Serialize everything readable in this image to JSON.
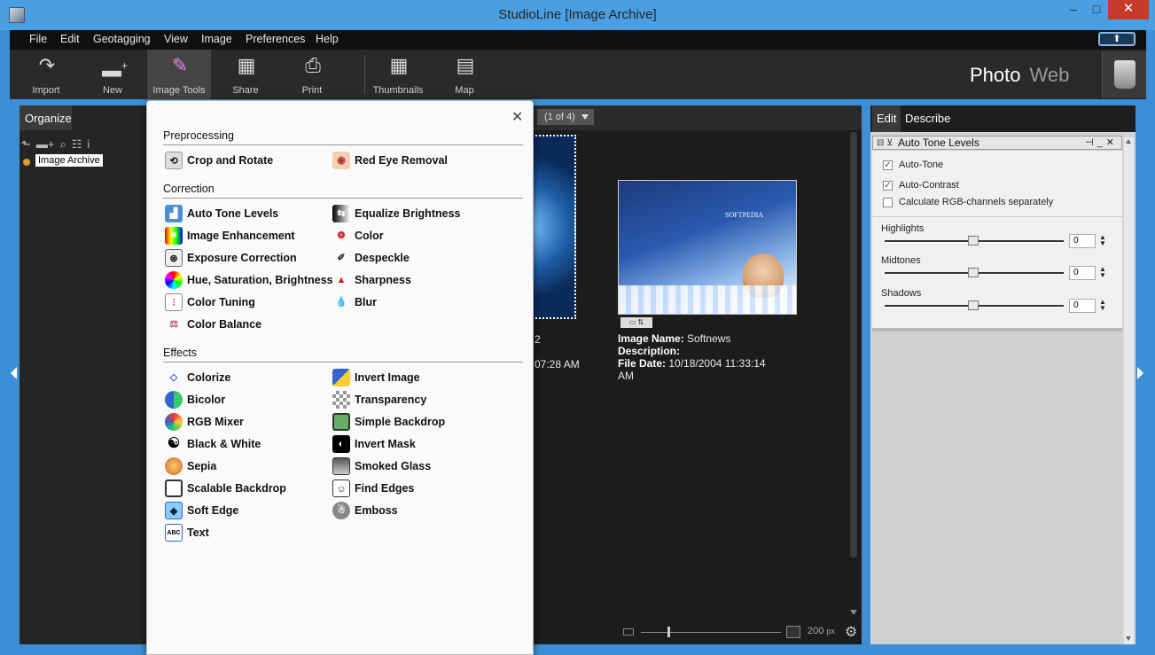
{
  "window": {
    "title": "StudioLine [Image Archive]",
    "min": "–",
    "max": "□",
    "close": "✕"
  },
  "menu": [
    "File",
    "Edit",
    "Geotagging",
    "View",
    "Image",
    "Preferences",
    "Help"
  ],
  "toolbar": {
    "import": "Import",
    "new": "New",
    "image_tools": "Image Tools",
    "share": "Share",
    "print": "Print",
    "thumbnails": "Thumbnails",
    "map": "Map",
    "photo": "Photo",
    "web": "Web"
  },
  "left": {
    "tab": "Organize",
    "tree_item": "Image Archive"
  },
  "center": {
    "page_indicator": "(1 of 4)",
    "thumb1_info": [
      "2",
      "07:28 AM"
    ],
    "thumb2_info": {
      "name_label": "Image Name:",
      "name_value": "Softnews",
      "desc_label": "Description:",
      "date_label": "File Date:",
      "date_value": "10/18/2004 11:33:14",
      "date_value2": "AM"
    },
    "zoom_value": "200",
    "zoom_unit": "px"
  },
  "right": {
    "tab_edit": "Edit",
    "tab_describe": "Describe",
    "panel_title": "Auto Tone Levels",
    "checkboxes": [
      {
        "label": "Auto-Tone",
        "checked": true
      },
      {
        "label": "Auto-Contrast",
        "checked": true
      },
      {
        "label": "Calculate RGB-channels separately",
        "checked": false
      }
    ],
    "sliders": [
      {
        "label": "Highlights",
        "value": "0"
      },
      {
        "label": "Midtones",
        "value": "0"
      },
      {
        "label": "Shadows",
        "value": "0"
      }
    ]
  },
  "popup": {
    "sections": {
      "preprocessing": "Preprocessing",
      "correction": "Correction",
      "effects": "Effects"
    },
    "preprocessing": [
      "Crop and Rotate",
      "Red Eye Removal"
    ],
    "correction_left": [
      "Auto Tone Levels",
      "Image Enhancement",
      "Exposure Correction",
      "Hue, Saturation, Brightness",
      "Color Tuning",
      "Color Balance"
    ],
    "correction_right": [
      "Equalize Brightness",
      "Color",
      "Despeckle",
      "Sharpness",
      "Blur"
    ],
    "effects_left": [
      "Colorize",
      "Bicolor",
      "RGB Mixer",
      "Black & White",
      "Sepia",
      "Scalable Backdrop",
      "Soft Edge",
      "Text"
    ],
    "effects_right": [
      "Invert Image",
      "Transparency",
      "Simple Backdrop",
      "Invert Mask",
      "Smoked Glass",
      "Find Edges",
      "Emboss"
    ]
  }
}
